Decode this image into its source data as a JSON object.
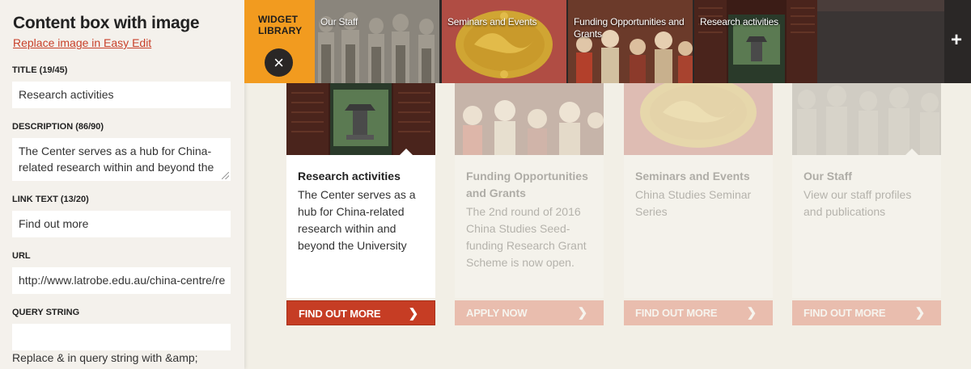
{
  "editor": {
    "title": "Content box with image",
    "replace_link": "Replace image in Easy Edit",
    "title_label": "TITLE (19/45)",
    "title_value": "Research activities",
    "description_label": "DESCRIPTION (86/90)",
    "description_value": "The Center serves as a hub for China-related research within and beyond the",
    "link_text_label": "LINK TEXT (13/20)",
    "link_text_value": "Find out more",
    "url_label": "URL",
    "url_value": "http://www.latrobe.edu.au/china-centre/re",
    "query_label": "QUERY STRING",
    "query_value": "",
    "query_note": "Replace & in query string with &amp;"
  },
  "library": {
    "label": "WIDGET LIBRARY",
    "close_icon": "close-icon",
    "add_icon": "plus-icon",
    "items": [
      {
        "label": "Our Staff"
      },
      {
        "label": "Seminars and Events"
      },
      {
        "label": "Funding Opportunities and Grants"
      },
      {
        "label": "Research activities"
      }
    ]
  },
  "cards": [
    {
      "title": "Research activities",
      "description": "The Center serves as a hub for China-related research within and beyond the University",
      "button": "FIND OUT MORE",
      "state": "active"
    },
    {
      "title": "Funding Opportunities and Grants",
      "description": "The 2nd round of 2016 China Studies Seed-funding Research Grant Scheme is now open.",
      "button": "APPLY NOW",
      "state": "faded"
    },
    {
      "title": "Seminars and Events",
      "description": "China Studies Seminar Series",
      "button": "FIND OUT MORE",
      "state": "faded"
    },
    {
      "title": "Our Staff",
      "description": "View our staff profiles and publications",
      "button": "FIND OUT MORE",
      "state": "faded"
    }
  ],
  "colors": {
    "accent": "#c63d24",
    "library_label_bg": "#f29b1f",
    "library_bg": "#2a2726",
    "page_bg": "#f2efe6",
    "panel_bg": "#f4f1ec"
  }
}
